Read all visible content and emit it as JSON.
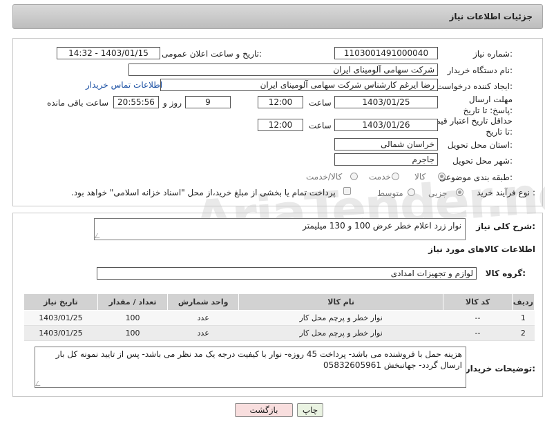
{
  "watermark": "AriaTender.neT",
  "header": {
    "title": "جزئیات اطلاعات نیاز"
  },
  "form": {
    "need_number_label": "شماره نیاز:",
    "need_number": "1103001491000040",
    "announce_label": "تاریخ و ساعت اعلان عمومی:",
    "announce_value": "1403/01/15 - 14:32",
    "buyer_label": "نام دستگاه خریدار:",
    "buyer_value": "شرکت سهامی آلومینای ایران",
    "creator_label": "ایجاد کننده درخواست:",
    "creator_value": "رضا ایرغم کارشناس شرکت سهامی آلومینای ایران",
    "contact_link": "اطلاعات تماس خریدار",
    "deadline_label": "مهلت ارسال پاسخ: تا تاریخ:",
    "deadline_date": "1403/01/25",
    "time_label": "ساعت",
    "deadline_time": "12:00",
    "days_value": "9",
    "days_label": "روز و",
    "remaining_time": "20:55:56",
    "remaining_label": "ساعت باقی مانده",
    "validity_label": "حداقل تاریخ اعتبار قیمت: تا تاریخ:",
    "validity_date": "1403/01/26",
    "validity_time": "12:00",
    "province_label": "استان محل تحویل:",
    "province_value": "خراسان شمالی",
    "city_label": "شهر محل تحویل:",
    "city_value": "جاجرم",
    "category_label": "طبقه بندی موضوعی:",
    "category_options": [
      "کالا",
      "خدمت",
      "کالا/خدمت"
    ],
    "category_selected": "کالا",
    "process_label": "نوع فرآیند خرید :",
    "process_options": [
      "جزیی",
      "متوسط"
    ],
    "process_selected": "جزیی",
    "payment_note": "پرداخت تمام یا بخشی از مبلغ خرید،از محل \"اسناد خزانه اسلامی\" خواهد بود."
  },
  "details": {
    "desc_label": "شرح کلی نیاز:",
    "desc_value": "نوار زرد اعلام خطر عرض 100 و 130 میلیمتر",
    "goods_info_title": "اطلاعات کالاهای مورد نیاز",
    "group_label": "گروه کالا:",
    "group_value": "لوازم و تجهیزات امدادی",
    "table": {
      "headers": [
        "ردیف",
        "کد کالا",
        "نام کالا",
        "واحد شمارش",
        "تعداد / مقدار",
        "تاریخ نیاز"
      ],
      "rows": [
        {
          "index": "1",
          "code": "--",
          "name": "نوار خطر و پرچم محل کار",
          "unit": "عدد",
          "qty": "100",
          "date": "1403/01/25"
        },
        {
          "index": "2",
          "code": "--",
          "name": "نوار خطر و پرچم محل کار",
          "unit": "عدد",
          "qty": "100",
          "date": "1403/01/25"
        }
      ]
    },
    "buyer_notes_label": "توضیحات خریدار:",
    "buyer_notes_value": "هزینه حمل با فروشنده می باشد- پرداخت 45 روزه- نوار با کیفیت درجه یک مد نظر می باشد- پس از تایید نمونه کل بار ارسال گردد- جهانبخش 05832605961"
  },
  "buttons": {
    "print": "چاپ",
    "back": "بازگشت"
  },
  "colors": {
    "link": "#1a4fa3",
    "print_bg": "#eaf3e2",
    "back_bg": "#f8dede"
  }
}
